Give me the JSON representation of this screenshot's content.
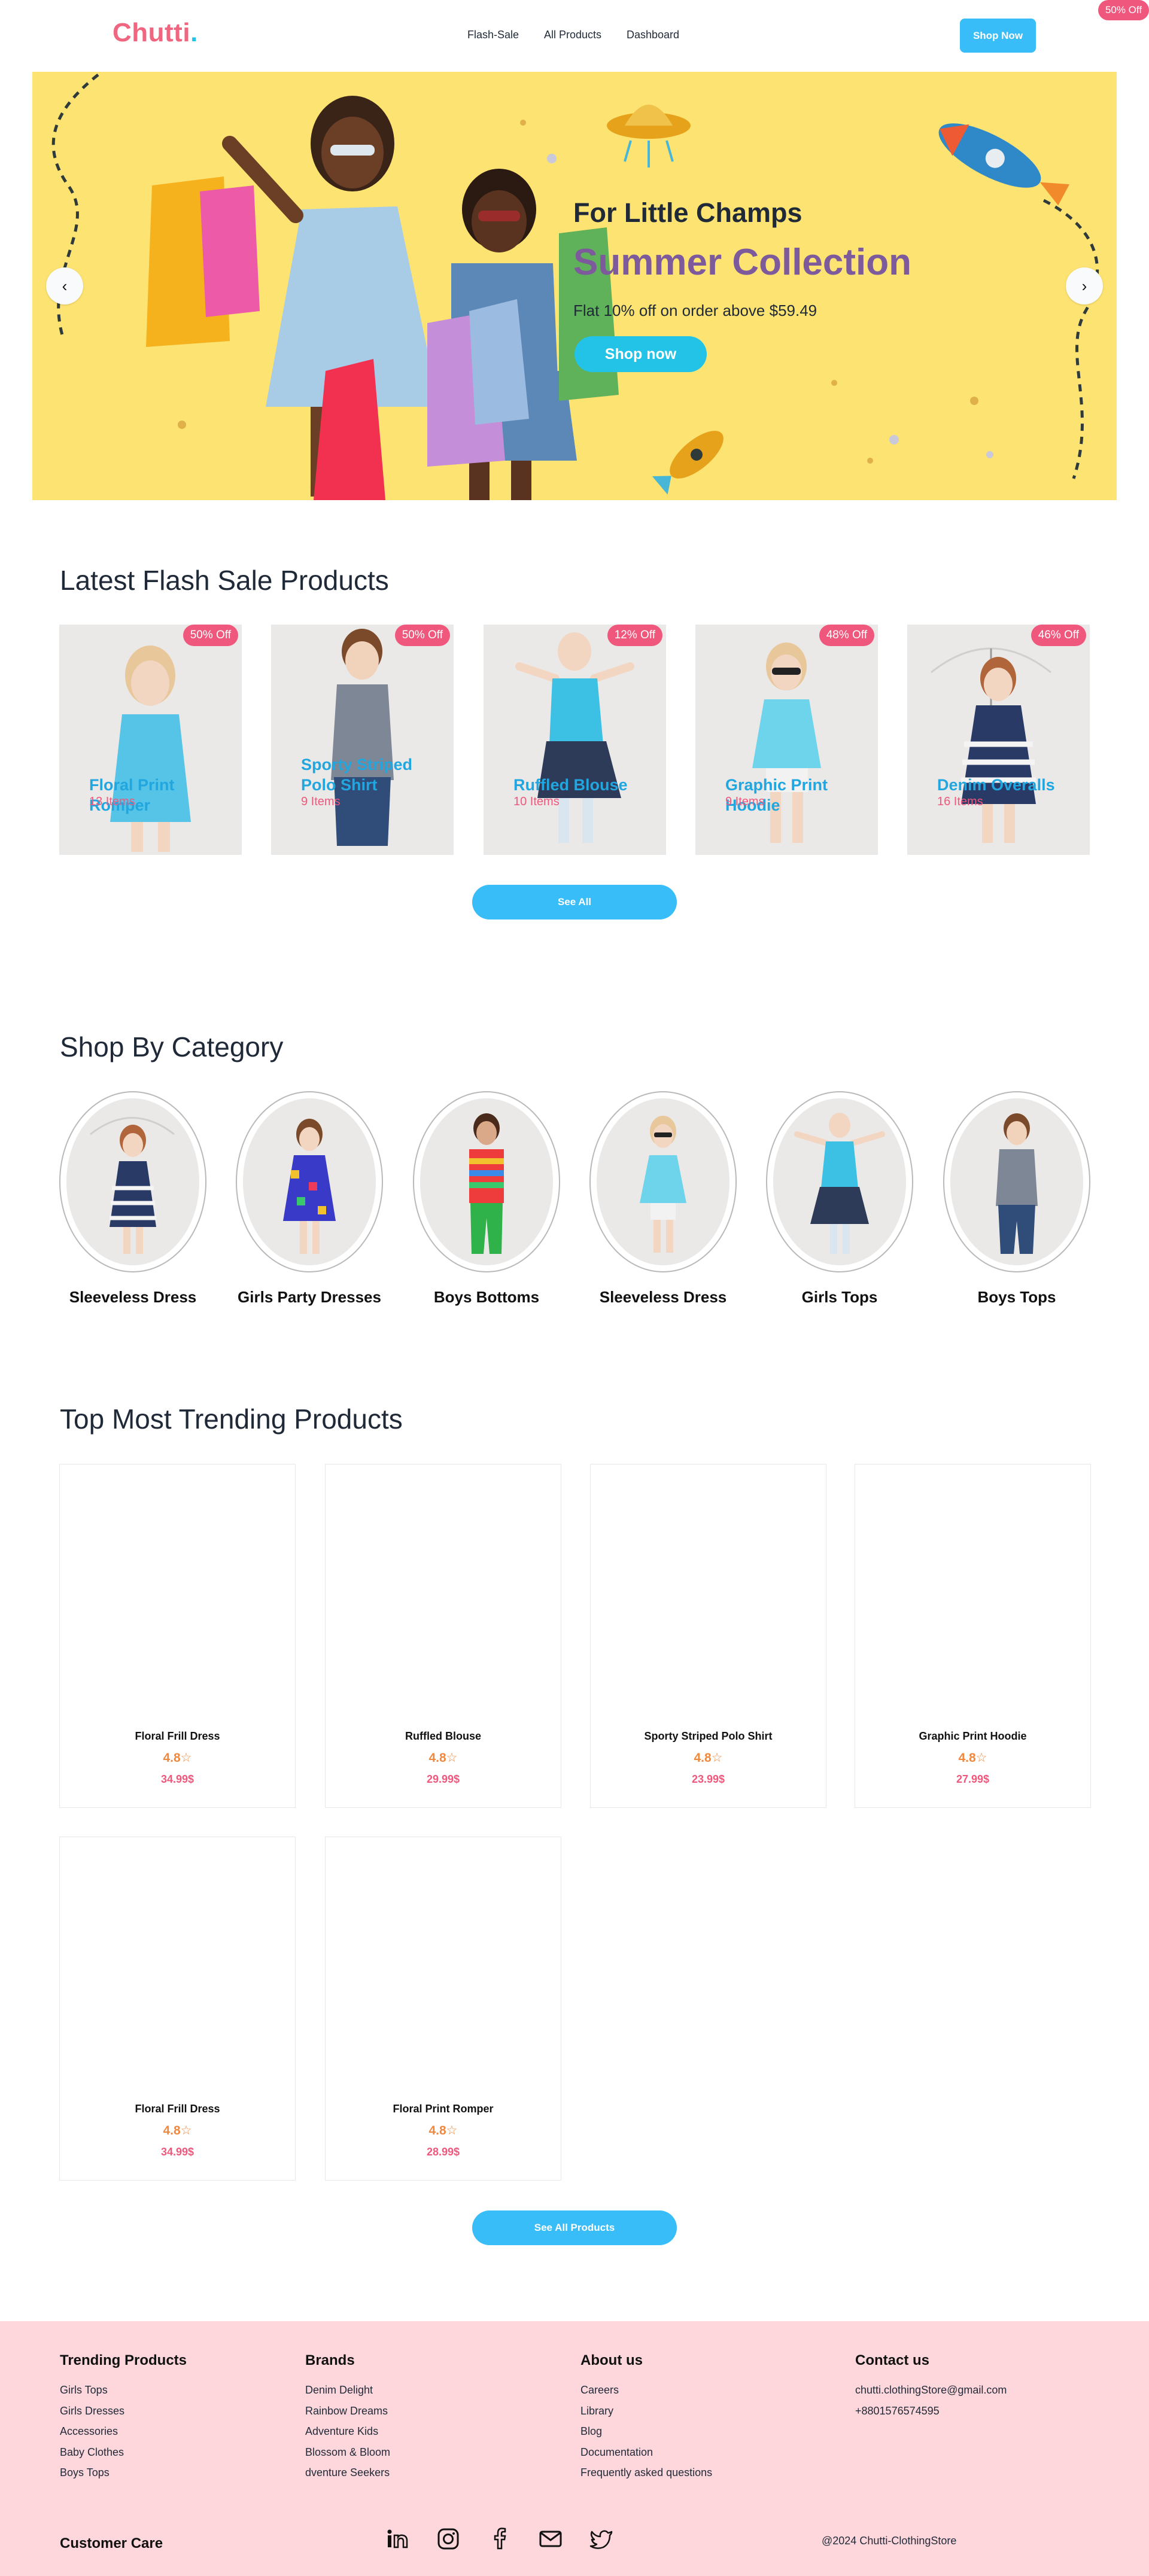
{
  "brand": {
    "name": "Chutti",
    "dot": "."
  },
  "nav": {
    "links": [
      "Flash-Sale",
      "All Products",
      "Dashboard"
    ],
    "cta": "Shop Now",
    "corner_badge": "50% Off"
  },
  "hero": {
    "tagline": "For Little Champs",
    "title": "Summer Collection",
    "subtitle": "Flat 10% off on order above $59.49",
    "button": "Shop now",
    "prev_icon": "chevron-left-icon",
    "next_icon": "chevron-right-icon",
    "prev_glyph": "‹",
    "next_glyph": "›"
  },
  "flash": {
    "title": "Latest Flash Sale Products",
    "items": [
      {
        "name": "Floral Print Romper",
        "count": "13 Items",
        "badge": "50% Off"
      },
      {
        "name": "Sporty Striped Polo Shirt",
        "count": "9 Items",
        "badge": "50% Off"
      },
      {
        "name": "Ruffled Blouse",
        "count": "10 Items",
        "badge": "12% Off"
      },
      {
        "name": "Graphic Print Hoodie",
        "count": "9 Items",
        "badge": "48% Off"
      },
      {
        "name": "Denim Overalls",
        "count": "16 Items",
        "badge": "46% Off"
      }
    ],
    "see_all": "See All"
  },
  "categories": {
    "title": "Shop By Category",
    "items": [
      "Sleeveless Dress",
      "Girls Party Dresses",
      "Boys Bottoms",
      "Sleeveless Dress",
      "Girls Tops",
      "Boys Tops"
    ]
  },
  "trending": {
    "title": "Top Most Trending Products",
    "items": [
      {
        "name": "Floral Frill Dress",
        "rating": "4.8☆",
        "price": "34.99$"
      },
      {
        "name": "Ruffled Blouse",
        "rating": "4.8☆",
        "price": "29.99$"
      },
      {
        "name": "Sporty Striped Polo Shirt",
        "rating": "4.8☆",
        "price": "23.99$"
      },
      {
        "name": "Graphic Print Hoodie",
        "rating": "4.8☆",
        "price": "27.99$"
      },
      {
        "name": "Floral Frill Dress",
        "rating": "4.8☆",
        "price": "34.99$"
      },
      {
        "name": "Floral Print Romper",
        "rating": "4.8☆",
        "price": "28.99$"
      }
    ],
    "see_all": "See All Products"
  },
  "footer": {
    "trending": {
      "title": "Trending Products",
      "items": [
        "Girls Tops",
        "Girls Dresses",
        "Accessories",
        "Baby Clothes",
        "Boys Tops"
      ]
    },
    "brands": {
      "title": "Brands",
      "items": [
        "Denim Delight",
        "Rainbow Dreams",
        "Adventure Kids",
        "Blossom & Bloom",
        "dventure Seekers"
      ]
    },
    "about": {
      "title": "About us",
      "items": [
        "Careers",
        "Library",
        "Blog",
        "Documentation",
        "Frequently asked questions"
      ]
    },
    "contact": {
      "title": "Contact us",
      "items": [
        "chutti.clothingStore@gmail.com",
        "+8801576574595"
      ]
    },
    "care": "Customer Care",
    "social_icons": [
      "linkedin-icon",
      "instagram-icon",
      "facebook-icon",
      "mail-icon",
      "twitter-icon"
    ],
    "copyright": "@2024 Chutti-ClothingStore"
  },
  "colors": {
    "brand_pink": "#f0657f",
    "accent_blue": "#38bdf8",
    "hero_yellow": "#fde371",
    "badge_pink": "#f0577c",
    "footer_pink": "#fed7dd"
  }
}
